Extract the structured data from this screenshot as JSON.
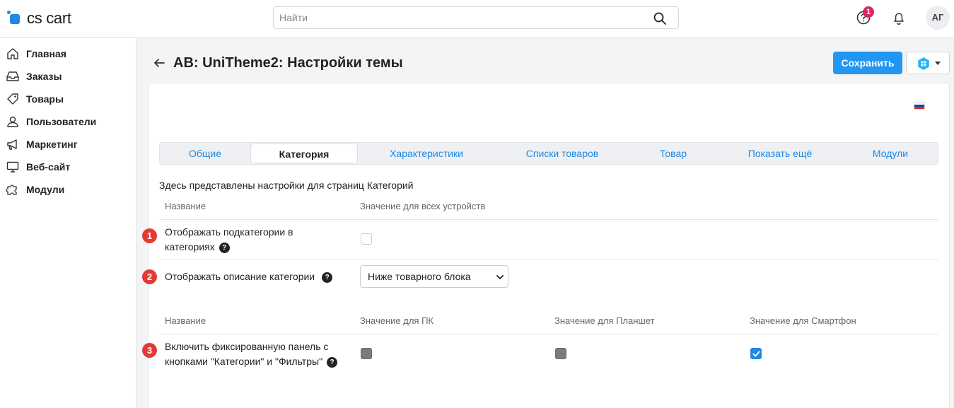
{
  "app": {
    "logo_text": "cs cart",
    "search_placeholder": "Найти",
    "notification_count": "1",
    "avatar_initials": "АГ",
    "brand_color": "#1e88e5"
  },
  "sidebar": {
    "items": [
      {
        "label": "Главная",
        "icon": "home-icon"
      },
      {
        "label": "Заказы",
        "icon": "inbox-icon"
      },
      {
        "label": "Товары",
        "icon": "tag-icon"
      },
      {
        "label": "Пользователи",
        "icon": "user-icon"
      },
      {
        "label": "Маркетинг",
        "icon": "megaphone-icon"
      },
      {
        "label": "Веб-сайт",
        "icon": "monitor-icon"
      },
      {
        "label": "Модули",
        "icon": "puzzle-icon"
      }
    ]
  },
  "page": {
    "title": "AB: UniTheme2: Настройки темы",
    "save_label": "Сохранить"
  },
  "tabs": [
    {
      "label": "Общие",
      "active": false
    },
    {
      "label": "Категория",
      "active": true
    },
    {
      "label": "Характеристики",
      "active": false
    },
    {
      "label": "Списки товаров",
      "active": false
    },
    {
      "label": "Товар",
      "active": false
    },
    {
      "label": "Показать ещё",
      "active": false
    },
    {
      "label": "Модули",
      "active": false
    }
  ],
  "content": {
    "intro": "Здесь представлены настройки для страниц Категорий",
    "section1": {
      "col_name": "Название",
      "col_value": "Значение для всех устройств",
      "rows": [
        {
          "num": "1",
          "label": "Отображать подкатегории в категориях",
          "help": "?",
          "control": "checkbox",
          "checked": false
        },
        {
          "num": "2",
          "label": "Отображать описание категории",
          "help": "?",
          "control": "select",
          "value": "Ниже товарного блока"
        }
      ]
    },
    "section2": {
      "col_name": "Название",
      "col_pc": "Значение для ПК",
      "col_tablet": "Значение для Планшет",
      "col_phone": "Значение для Смартфон",
      "rows": [
        {
          "num": "3",
          "label": "Включить фиксированную панель с кнопками \"Категории\" и \"Фильтры\"",
          "help": "?",
          "pc": "disabled",
          "tablet": "disabled",
          "phone": "checked"
        }
      ]
    }
  }
}
